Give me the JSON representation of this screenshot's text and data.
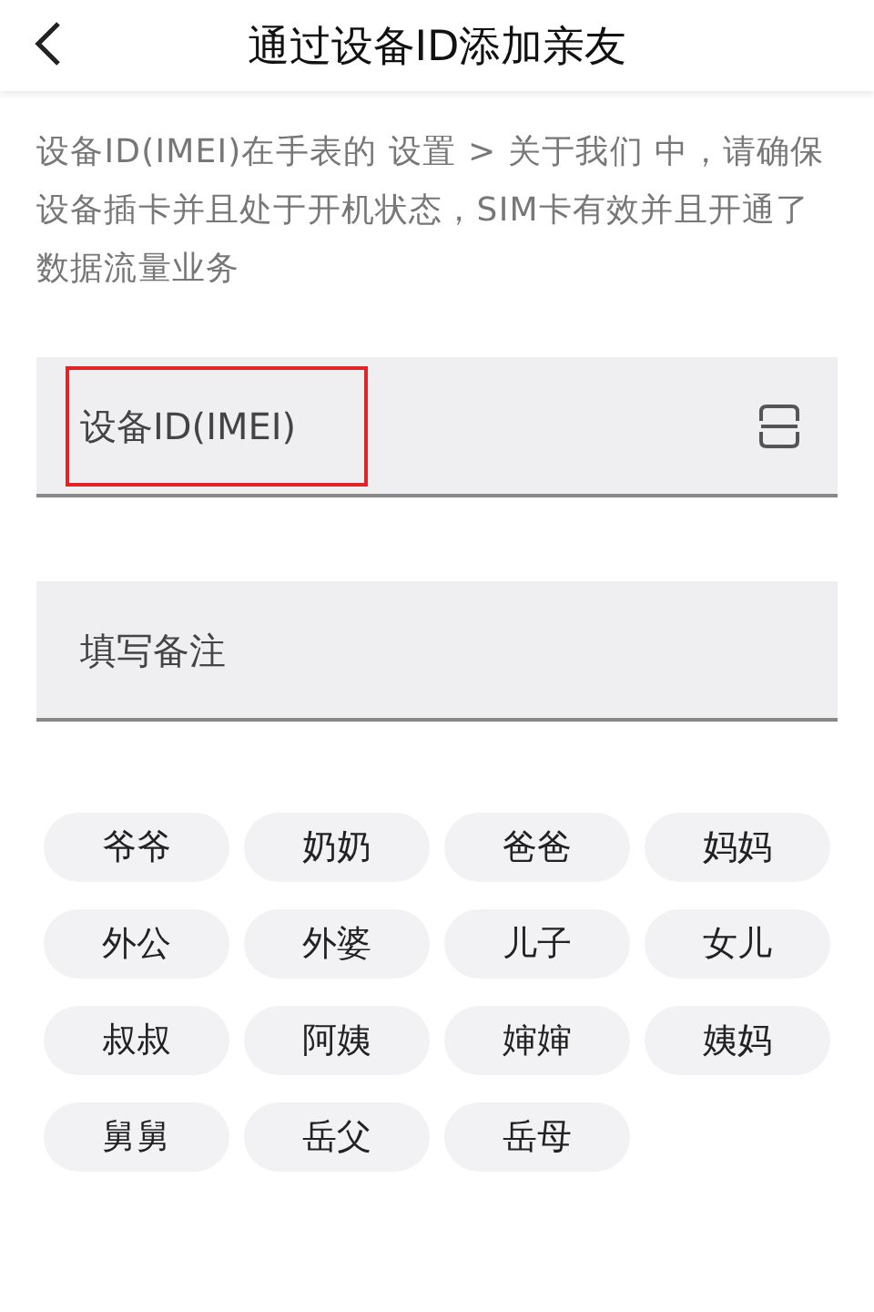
{
  "header": {
    "title": "通过设备ID添加亲友"
  },
  "description": "设备ID(IMEI)在手表的 设置 > 关于我们 中，请确保设备插卡并且处于开机状态，SIM卡有效并且开通了数据流量业务",
  "fields": [
    {
      "placeholder": "设备ID(IMEI)",
      "highlighted": true,
      "kind": "scan"
    },
    {
      "placeholder": "填写备注",
      "highlighted": false,
      "kind": "plain"
    }
  ],
  "chips": [
    "爷爷",
    "奶奶",
    "爸爸",
    "妈妈",
    "外公",
    "外婆",
    "儿子",
    "女儿",
    "叔叔",
    "阿姨",
    "婶婶",
    "姨妈",
    "舅舅",
    "岳父",
    "岳母"
  ]
}
